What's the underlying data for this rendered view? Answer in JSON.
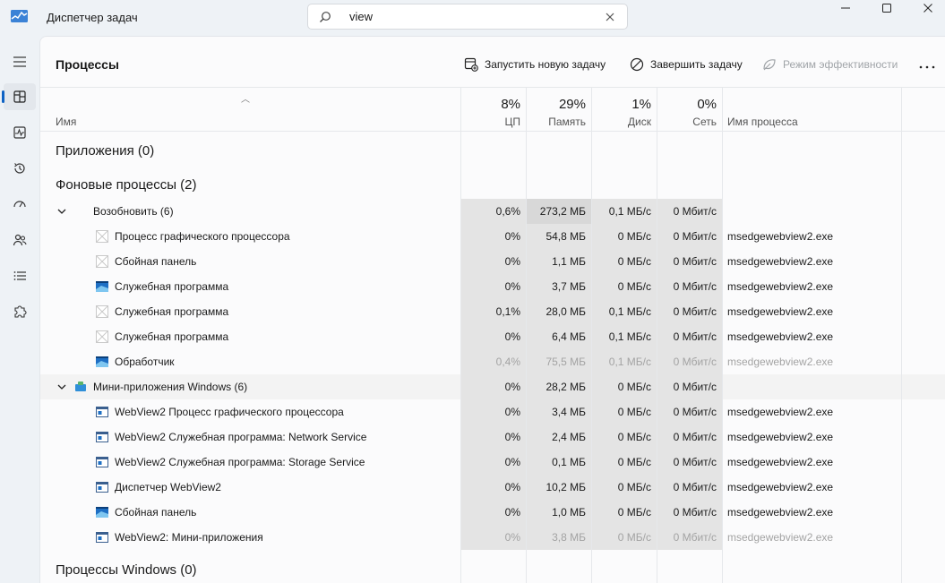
{
  "app": {
    "title": "Диспетчер задач"
  },
  "search": {
    "value": "view"
  },
  "page": {
    "title": "Процессы",
    "commands": {
      "new_task": "Запустить новую задачу",
      "end_task": "Завершить задачу",
      "efficiency": "Режим эффективности"
    }
  },
  "columns": {
    "name": "Имя",
    "cpu": {
      "pct": "8%",
      "label": "ЦП"
    },
    "memory": {
      "pct": "29%",
      "label": "Память"
    },
    "disk": {
      "pct": "1%",
      "label": "Диск"
    },
    "network": {
      "pct": "0%",
      "label": "Сеть"
    },
    "process_name": "Имя процесса"
  },
  "sections": {
    "apps": "Приложения (0)",
    "background": "Фоновые процессы (2)",
    "windows": "Процессы Windows (0)"
  },
  "groups": [
    {
      "name": "Возобновить (6)",
      "cpu": "0,6%",
      "mem": "273,2 МБ",
      "disk": "0,1 МБ/с",
      "net": "0 Мбит/с"
    },
    {
      "name": "Мини-приложения Windows (6)",
      "cpu": "0%",
      "mem": "28,2 МБ",
      "disk": "0 МБ/с",
      "net": "0 Мбит/с"
    }
  ],
  "processes": [
    {
      "name": "Процесс графического процессора",
      "cpu": "0%",
      "mem": "54,8 МБ",
      "disk": "0 МБ/с",
      "net": "0 Мбит/с",
      "pname": "msedgewebview2.exe",
      "icon": "blank-window-icon"
    },
    {
      "name": "Сбойная панель",
      "cpu": "0%",
      "mem": "1,1 МБ",
      "disk": "0 МБ/с",
      "net": "0 Мбит/с",
      "pname": "msedgewebview2.exe",
      "icon": "blank-window-icon"
    },
    {
      "name": "Служебная программа",
      "cpu": "0%",
      "mem": "3,7 МБ",
      "disk": "0 МБ/с",
      "net": "0 Мбит/с",
      "pname": "msedgewebview2.exe",
      "icon": "webview-app-icon"
    },
    {
      "name": "Служебная программа",
      "cpu": "0,1%",
      "mem": "28,0 МБ",
      "disk": "0,1 МБ/с",
      "net": "0 Мбит/с",
      "pname": "msedgewebview2.exe",
      "icon": "blank-window-icon"
    },
    {
      "name": "Служебная программа",
      "cpu": "0%",
      "mem": "6,4 МБ",
      "disk": "0,1 МБ/с",
      "net": "0 Мбит/с",
      "pname": "msedgewebview2.exe",
      "icon": "blank-window-icon"
    },
    {
      "name": "Обработчик",
      "cpu": "0,4%",
      "mem": "75,5 МБ",
      "disk": "0,1 МБ/с",
      "net": "0 Мбит/с",
      "pname": "msedgewebview2.exe",
      "icon": "webview-app-icon"
    },
    {
      "name": "WebView2 Процесс графического процессора",
      "cpu": "0%",
      "mem": "3,4 МБ",
      "disk": "0 МБ/с",
      "net": "0 Мбит/с",
      "pname": "msedgewebview2.exe",
      "icon": "window-app-icon"
    },
    {
      "name": "WebView2 Служебная программа: Network Service",
      "cpu": "0%",
      "mem": "2,4 МБ",
      "disk": "0 МБ/с",
      "net": "0 Мбит/с",
      "pname": "msedgewebview2.exe",
      "icon": "window-app-icon"
    },
    {
      "name": "WebView2 Служебная программа: Storage Service",
      "cpu": "0%",
      "mem": "0,1 МБ",
      "disk": "0 МБ/с",
      "net": "0 Мбит/с",
      "pname": "msedgewebview2.exe",
      "icon": "window-app-icon"
    },
    {
      "name": "Диспетчер WebView2",
      "cpu": "0%",
      "mem": "10,2 МБ",
      "disk": "0 МБ/с",
      "net": "0 Мбит/с",
      "pname": "msedgewebview2.exe",
      "icon": "window-app-icon"
    },
    {
      "name": "Сбойная панель",
      "cpu": "0%",
      "mem": "1,0 МБ",
      "disk": "0 МБ/с",
      "net": "0 Мбит/с",
      "pname": "msedgewebview2.exe",
      "icon": "webview-app-icon"
    },
    {
      "name": "WebView2: Мини-приложения",
      "cpu": "0%",
      "mem": "3,8 МБ",
      "disk": "0 МБ/с",
      "net": "0 Мбит/с",
      "pname": "msedgewebview2.exe",
      "icon": "window-app-icon"
    }
  ],
  "colors": {
    "accent": "#0e62c4",
    "heat_light": "#e4e4e4",
    "heat_medium": "#d8d8d8"
  }
}
